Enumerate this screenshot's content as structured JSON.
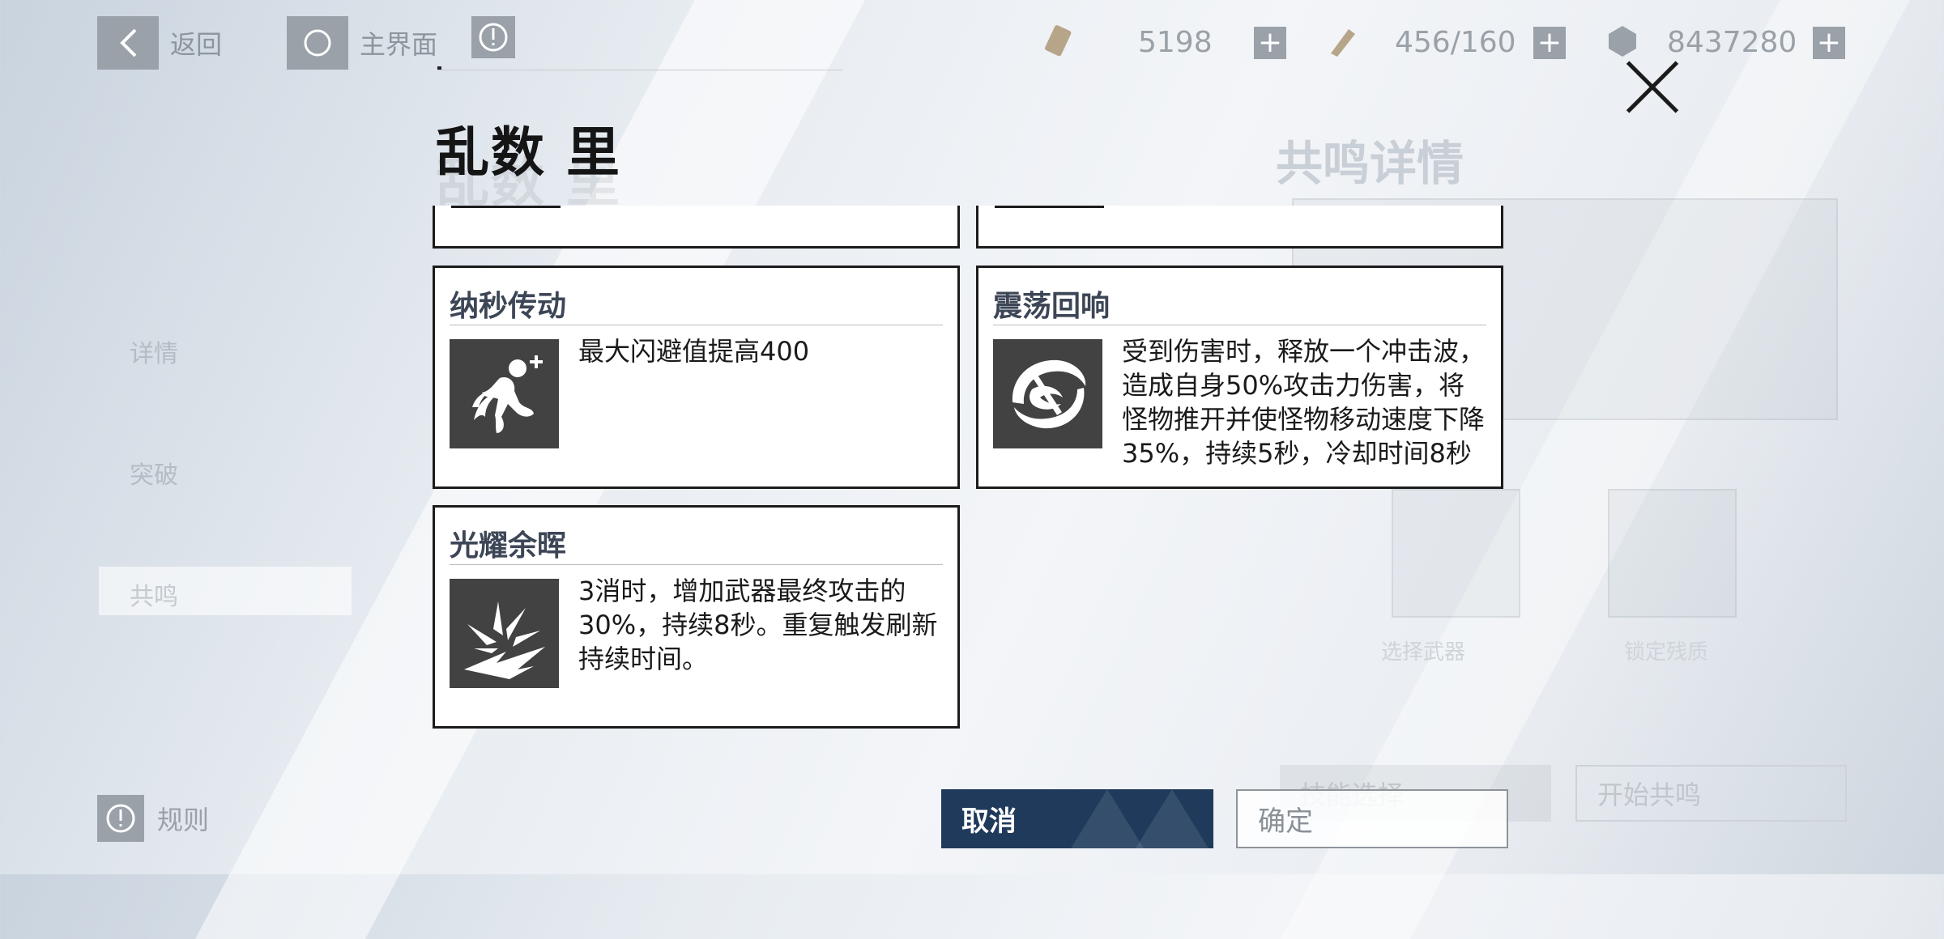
{
  "topbar": {
    "back_label": "返回",
    "home_label": "主界面",
    "resources": [
      {
        "icon": "ticket-icon",
        "value": "5198"
      },
      {
        "icon": "stamina-icon",
        "value": "456/160"
      },
      {
        "icon": "coin-icon",
        "value": "8437280"
      }
    ]
  },
  "background": {
    "side_tabs": [
      "详情",
      "突破",
      "共鸣"
    ],
    "panel_title": "共鸣详情",
    "slot_labels": [
      "选择武器",
      "锁定残质"
    ],
    "skill_select_label": "技能选择",
    "start_resonance_label": "开始共鸣",
    "rules_label": "规则"
  },
  "dialog": {
    "title": "乱数 里",
    "cards": [
      {
        "name": "纳秒传动",
        "icon": "dodge-figure-icon",
        "desc": "最大闪避值提高400"
      },
      {
        "name": "震荡回响",
        "icon": "shockwave-icon",
        "desc": "受到伤害时，释放一个冲击波，造成自身50%攻击力伤害，将怪物推开并使怪物移动速度下降35%，持续5秒，冷却时间8秒"
      },
      {
        "name": "光耀余晖",
        "icon": "burst-icon",
        "desc": "3消时，增加武器最终攻击的30%，持续8秒。重复触发刷新持续时间。"
      }
    ],
    "cancel_label": "取消",
    "confirm_label": "确定"
  },
  "colors": {
    "cancel_bg": "#1f3a5b",
    "card_border": "#1c1c1c",
    "icon_bg": "#424242",
    "card_title": "#3c4656"
  }
}
